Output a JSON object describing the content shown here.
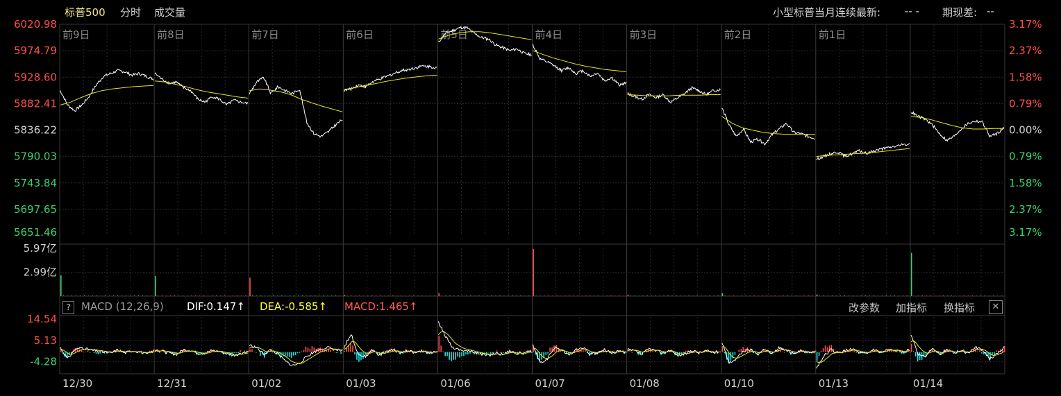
{
  "header": {
    "title": "标普500",
    "tab_intraday": "分时",
    "tab_volume": "成交量",
    "contract_label": "小型标普当月连续最新:",
    "contract_value": "-- -",
    "basis_label": "期现差:",
    "basis_value": "--"
  },
  "macd_bar": {
    "help": "?",
    "name": "MACD (12,26,9)",
    "dif": "DIF:0.147↑",
    "dea": "DEA:-0.585↑",
    "macd": "MACD:1.465↑",
    "btn_params": "改参数",
    "btn_add": "加指标",
    "btn_switch": "换指标",
    "close": "✕"
  },
  "colors": {
    "up": "#ff4d4d",
    "down": "#3cd26e",
    "price_line": "#ffffff",
    "avg_line": "#e6e619",
    "macd_neg_bar": "#19e6e6",
    "grid": "#2a2a2a",
    "day_sep": "#3c3c3c"
  },
  "chart_data": [
    {
      "type": "line",
      "name": "price",
      "y_ticks_left": [
        "6020.98",
        "5974.79",
        "5928.60",
        "5882.41",
        "5836.22",
        "5790.03",
        "5743.84",
        "5697.65",
        "5651.46"
      ],
      "y_ticks_right": [
        "3.17%",
        "2.37%",
        "1.58%",
        "0.79%",
        "0.00%",
        "0.79%",
        "1.58%",
        "2.37%",
        "3.17%"
      ],
      "ylim": [
        5651.46,
        6020.98
      ],
      "base": 5836.22,
      "day_labels": [
        "前9日",
        "前8日",
        "前7日",
        "前6日",
        "前5日",
        "前4日",
        "前3日",
        "前2日",
        "前1日",
        ""
      ],
      "x_labels": [
        "12/30",
        "12/31",
        "01/02",
        "01/03",
        "01/06",
        "01/07",
        "01/08",
        "01/10",
        "01/13",
        "01/14"
      ],
      "days": [
        {
          "price": [
            5905,
            5880,
            5870,
            5880,
            5895,
            5915,
            5930,
            5935,
            5940,
            5938,
            5932,
            5935,
            5930,
            5925
          ],
          "avg": [
            5880,
            5885,
            5893,
            5900,
            5905,
            5908,
            5910,
            5912,
            5913,
            5914
          ]
        },
        {
          "price": [
            5935,
            5925,
            5918,
            5920,
            5910,
            5905,
            5890,
            5885,
            5895,
            5890,
            5880,
            5888,
            5885,
            5882
          ],
          "avg": [
            5922,
            5920,
            5916,
            5912,
            5907,
            5903,
            5900,
            5897,
            5894,
            5892
          ]
        },
        {
          "price": [
            5900,
            5920,
            5928,
            5900,
            5912,
            5905,
            5900,
            5908,
            5850,
            5830,
            5825,
            5833,
            5845,
            5855
          ],
          "avg": [
            5905,
            5908,
            5906,
            5903,
            5898,
            5890,
            5884,
            5878,
            5873,
            5868
          ]
        },
        {
          "price": [
            5905,
            5908,
            5915,
            5912,
            5920,
            5925,
            5930,
            5935,
            5940,
            5942,
            5945,
            5948,
            5947,
            5945
          ],
          "avg": [
            5907,
            5910,
            5914,
            5917,
            5921,
            5924,
            5927,
            5929,
            5931,
            5932
          ]
        },
        {
          "price": [
            5990,
            6005,
            6010,
            6015,
            6015,
            6005,
            5998,
            5995,
            5985,
            5980,
            5975,
            5978,
            5970,
            5968
          ],
          "avg": [
            5995,
            6002,
            6006,
            6008,
            6008,
            6006,
            6003,
            6000,
            5997,
            5994
          ]
        },
        {
          "price": [
            5985,
            5960,
            5955,
            5948,
            5940,
            5945,
            5935,
            5940,
            5930,
            5936,
            5922,
            5928,
            5915,
            5918
          ],
          "avg": [
            5975,
            5968,
            5962,
            5957,
            5952,
            5948,
            5945,
            5942,
            5940,
            5938
          ]
        },
        {
          "price": [
            5900,
            5895,
            5890,
            5898,
            5893,
            5898,
            5885,
            5892,
            5900,
            5910,
            5905,
            5898,
            5905,
            5907
          ],
          "avg": [
            5898,
            5897,
            5896,
            5896,
            5896,
            5897,
            5897,
            5897,
            5898,
            5898
          ]
        },
        {
          "price": [
            5875,
            5845,
            5825,
            5838,
            5815,
            5820,
            5812,
            5828,
            5838,
            5848,
            5832,
            5830,
            5825,
            5822
          ],
          "avg": [
            5860,
            5848,
            5840,
            5836,
            5832,
            5830,
            5829,
            5829,
            5829,
            5829
          ]
        },
        {
          "price": [
            5785,
            5790,
            5795,
            5798,
            5790,
            5795,
            5800,
            5795,
            5800,
            5803,
            5805,
            5808,
            5810,
            5812
          ],
          "avg": [
            5790,
            5792,
            5793,
            5794,
            5795,
            5796,
            5798,
            5800,
            5802,
            5804
          ]
        },
        {
          "price": [
            5868,
            5860,
            5855,
            5845,
            5830,
            5818,
            5825,
            5838,
            5848,
            5852,
            5850,
            5825,
            5830,
            5840
          ],
          "avg": [
            5860,
            5858,
            5854,
            5849,
            5844,
            5840,
            5838,
            5838,
            5839,
            5839
          ]
        }
      ]
    },
    {
      "type": "bar",
      "name": "volume",
      "y_ticks": [
        "5.97亿",
        "2.99亿"
      ],
      "ylim": [
        0,
        5.97
      ],
      "day_open_spike": [
        2.6,
        2.5,
        2.3,
        0.15,
        0.4,
        5.9,
        0.2,
        0.4,
        0.2,
        5.4
      ],
      "spike_color": [
        "down",
        "down",
        "up",
        "up",
        "up",
        "up",
        "up",
        "down",
        "down",
        "down"
      ],
      "baseline": 0.05
    },
    {
      "type": "line",
      "name": "MACD",
      "y_ticks": [
        "14.54",
        "5.13",
        "-4.28"
      ],
      "ylim": [
        -9.0,
        15.5
      ],
      "day_pattern": [
        [
          2,
          -3,
          1,
          2,
          1,
          0.5,
          0,
          -0.5,
          1,
          -0.4,
          0.6,
          0.2,
          -1,
          0.5
        ],
        [
          1,
          0.5,
          -0.5,
          -1,
          1,
          0.8,
          -0.6,
          -0.5,
          0.7,
          0.3,
          -0.7,
          -1.5,
          -0.5,
          0.2
        ],
        [
          3,
          2,
          -1,
          1,
          -1,
          -4,
          -6,
          -5,
          -2,
          0,
          1.5,
          2,
          1,
          0.5
        ],
        [
          2,
          8,
          -1,
          -2,
          1,
          -1.5,
          0.5,
          1,
          -0.3,
          0.8,
          -0.5,
          0.6,
          -0.4,
          0.3
        ],
        [
          13,
          7,
          2,
          1,
          0.5,
          0,
          -1,
          -1.5,
          -0.5,
          -1,
          0.6,
          -0.8,
          -0.4,
          0.2
        ],
        [
          3,
          -5,
          -3,
          2,
          1,
          -1.5,
          1,
          2,
          -1,
          -0.5,
          1,
          -0.5,
          0.5,
          -0.3
        ],
        [
          1,
          0.5,
          -1,
          1.5,
          0.5,
          -0.5,
          1,
          -1.5,
          -1,
          0.8,
          -0.4,
          0.6,
          -0.2,
          0.3
        ],
        [
          4,
          -5,
          -3,
          0.5,
          1,
          -1,
          1.5,
          -1,
          2,
          0.5,
          -0.5,
          0.8,
          -0.3,
          0.2
        ],
        [
          -7,
          -2,
          1,
          -0.5,
          0.5,
          1.5,
          -0.5,
          -1,
          1.2,
          -0.5,
          1,
          0.5,
          0.3,
          0.8
        ],
        [
          8,
          -1,
          -2,
          2,
          -1,
          1,
          -0.5,
          0.8,
          -0.3,
          2,
          1,
          -3,
          -1,
          2
        ]
      ]
    }
  ]
}
